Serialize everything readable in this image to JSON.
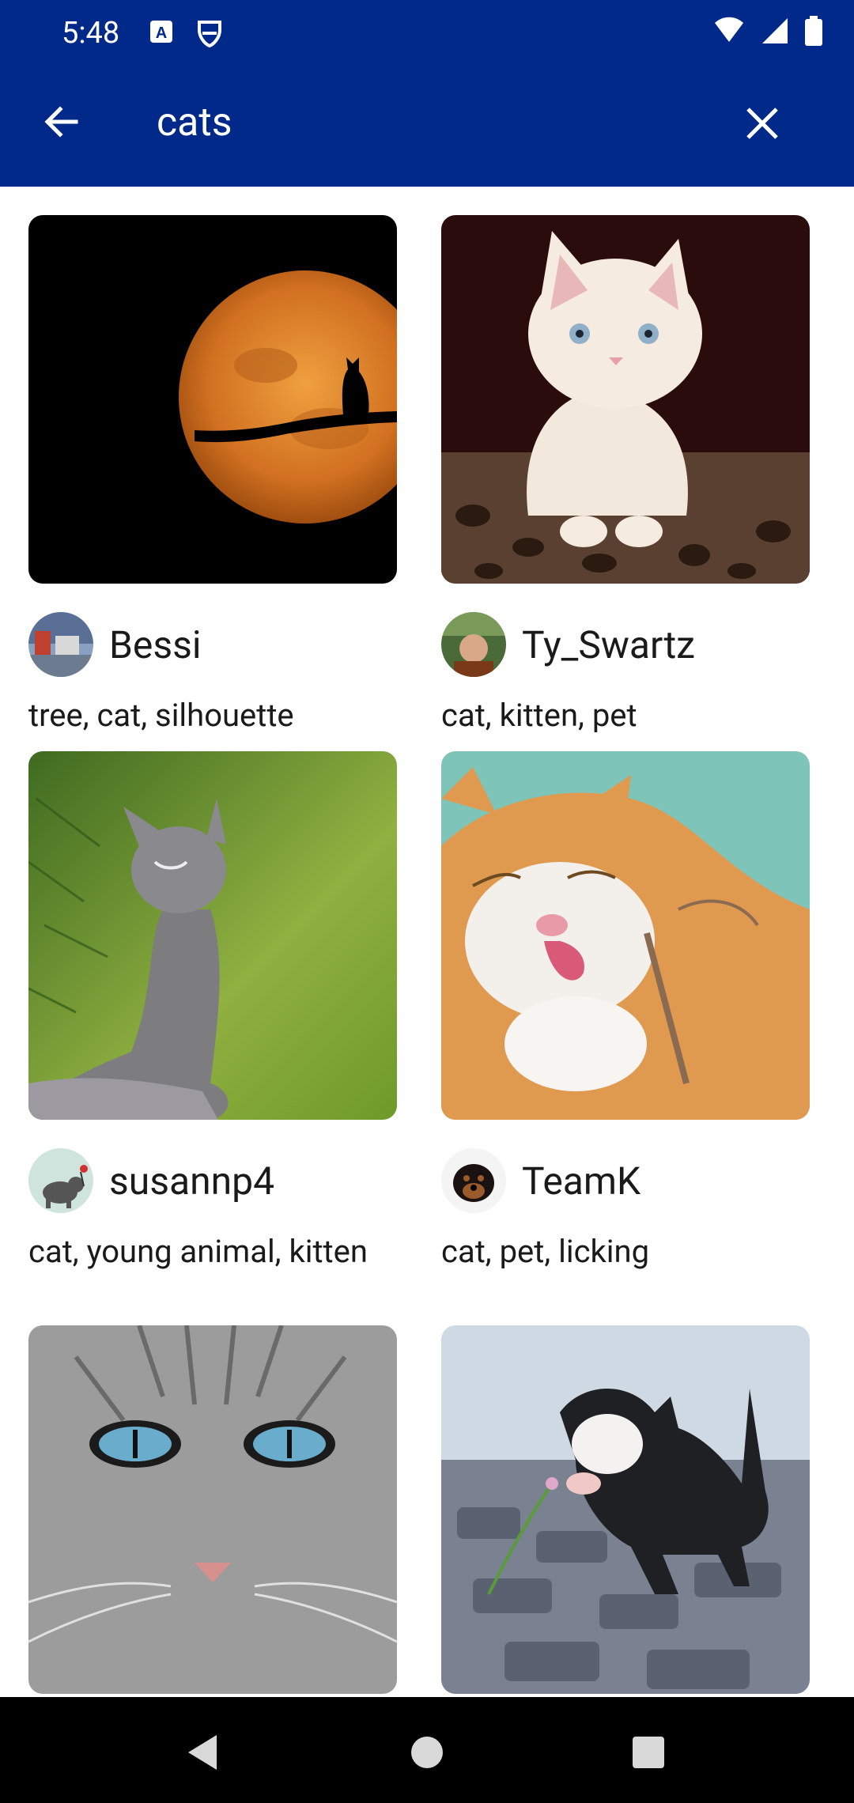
{
  "status_bar": {
    "time": "5:48"
  },
  "app_bar": {
    "query": "cats"
  },
  "results": [
    {
      "author": "Bessi",
      "tags": "tree, cat, silhouette"
    },
    {
      "author": "Ty_Swartz",
      "tags": "cat, kitten, pet"
    },
    {
      "author": "susannp4",
      "tags": "cat, young animal, kitten"
    },
    {
      "author": "TeamK",
      "tags": "cat, pet, licking"
    }
  ],
  "icons": {
    "back": "arrow-left-icon",
    "close": "close-icon",
    "nav_back": "triangle-back-icon",
    "nav_home": "circle-home-icon",
    "nav_recents": "square-recents-icon"
  },
  "colors": {
    "primary": "#01298a",
    "nav_bar": "#000000",
    "text": "#1a1a1a"
  }
}
